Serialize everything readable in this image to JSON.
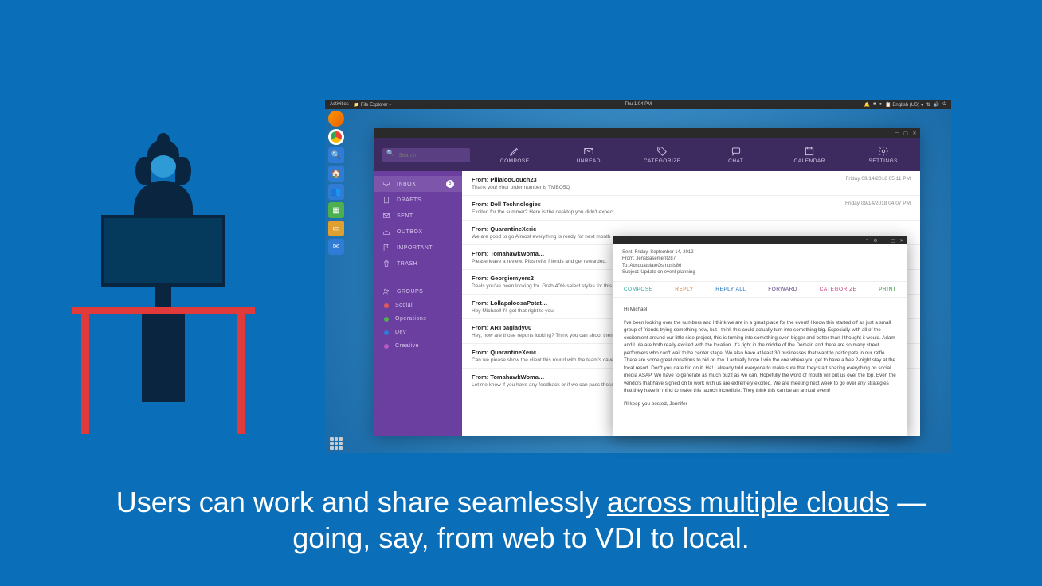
{
  "topbar": {
    "activities": "Activities",
    "app": "File Explorer",
    "clock": "Thu  1:04 PM",
    "lang": "English (US)"
  },
  "dock": {
    "apps": [
      "Firefox",
      "Chrome",
      "Search",
      "Home",
      "Files",
      "Spreadsheet",
      "Notes",
      "Mail"
    ]
  },
  "mail": {
    "toolbar": {
      "search_placeholder": "Search",
      "compose": "COMPOSE",
      "unread": "UNREAD",
      "categorize": "CATEGORIZE",
      "chat": "CHAT",
      "calendar": "CALENDAR",
      "settings": "SETTINGS"
    },
    "sidebar": {
      "inbox": "INBOX",
      "inbox_count": "6",
      "drafts": "DRAFTS",
      "sent": "SENT",
      "outbox": "OUTBOX",
      "important": "IMPORTANT",
      "trash": "TRASH",
      "groups": "GROUPS",
      "group_social": "Social",
      "group_operations": "Operations",
      "group_dev": "Dev",
      "group_creative": "Creative"
    },
    "messages": [
      {
        "from": "From: PillalooCouch23",
        "preview": "Thank you! Your order number is TMBQ5Q",
        "date": "Friday 09/14/2018 05:11 PM"
      },
      {
        "from": "From: Dell Technologies",
        "preview": "Excited for the summer? Here is the desktop you didn't expect",
        "date": "Friday 09/14/2018 04:07 PM"
      },
      {
        "from": "From: QuarantineXeric",
        "preview": "We are good to go Almost everything is ready for next month",
        "date": ""
      },
      {
        "from": "From: TomahawkWoma…",
        "preview": "Please leave a review. Plus refer friends and get rewarded.",
        "date": ""
      },
      {
        "from": "From: Georgiemyers2",
        "preview": "Deals you've been looking for. Grab 40% select styles for this li",
        "date": ""
      },
      {
        "from": "From: LollapaloosaPotat…",
        "preview": "Hey Michael! I'll get that right to you",
        "date": ""
      },
      {
        "from": "From: ARTbaglady00",
        "preview": "Hey, how are those reports looking? Think you can shoot them",
        "date": ""
      },
      {
        "from": "From: QuarantineXeric",
        "preview": "Can we please show the client this round with the team's cave",
        "date": ""
      },
      {
        "from": "From: TomahawkWoma…",
        "preview": "Let me know if you have any feedback or if we can pass these",
        "date": ""
      }
    ]
  },
  "reader": {
    "meta": {
      "sent": "Sent: Friday, September 14, 2012",
      "from": "From: JensBasement287",
      "to": "To: AbsquatulateOsmosis86",
      "subject": "Subject: Update on event planning"
    },
    "actions": {
      "compose": "COMPOSE",
      "reply": "REPLY",
      "reply_all": "REPLY ALL",
      "forward": "FORWARD",
      "categorize": "CATEGORIZE",
      "print": "PRINT"
    },
    "greeting": "Hi Michael,",
    "body": "I've been looking over the numbers and I think we are in a great place for the event! I know this started off as just a small group of friends trying something new, but I think this could actually turn into something big. Especially with all of the excitement around our little side project, this is turning into something even bigger and better than I thought it would.   Adam and Lula are both really excited with the location. It's right in the middle of the Domain and there are so many street performers who can't wait to be center stage. We also have at least 30 businesses that want to participate in our raffle. There are some great donations to bid on too. I actually hope I win the one where you get to have a free 2-night stay at the local resort. Don't you dare bid on it. Ha!  I already told everyone to make sure that they start sharing everything on social media ASAP. We have to generate as much buzz as we can. Hopefully the word of mouth will put us over the top. Even the vendors that have signed on to work with us are extremely excited. We are meeting next week to go over any strategies that they have in mind to make this launch incredible. They think this can be an annual event!",
    "signoff": "I'll keep you posted, Jennifer"
  },
  "caption": {
    "part1": "Users can work and share seamlessly ",
    "underline": "across multiple clouds",
    "part2": " — going, say, from web to VDI to local."
  }
}
